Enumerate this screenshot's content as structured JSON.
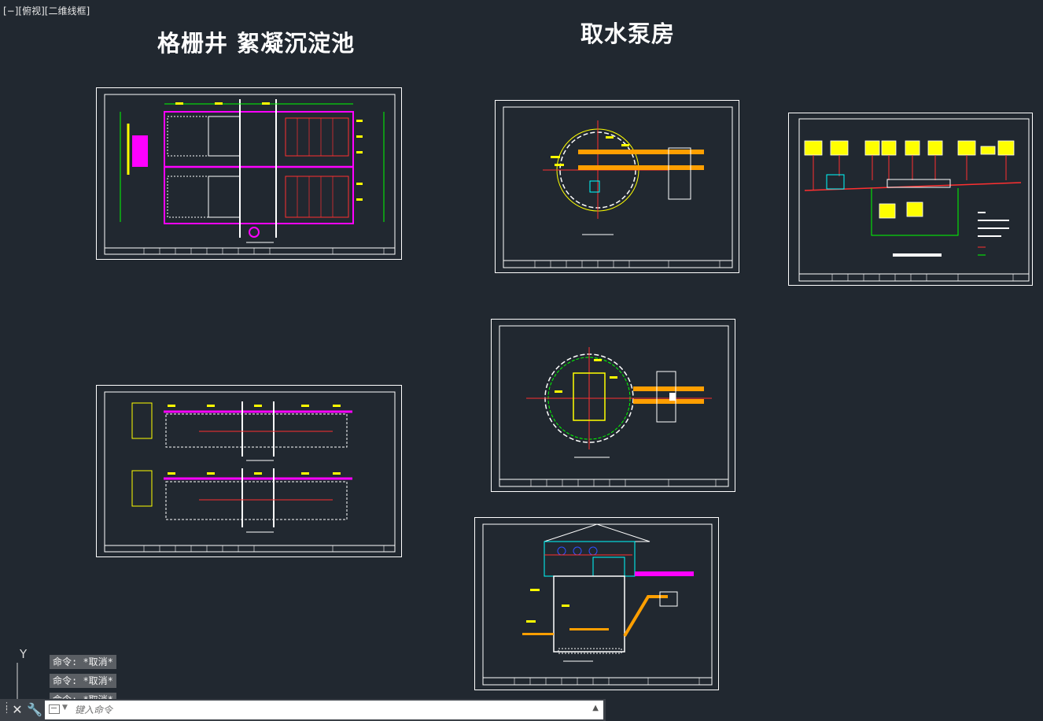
{
  "viewport": {
    "label": "[−][俯视][二维线框]"
  },
  "titles": {
    "left": "格栅井  絮凝沉淀池",
    "right": "取水泵房"
  },
  "colors": {
    "background": "#212830",
    "frame": "#ffffff",
    "yellow": "#ffff00",
    "magenta": "#ff00ff",
    "red": "#ff3030",
    "green": "#00ff00",
    "cyan": "#00ffff",
    "blue": "#3050ff",
    "orange": "#ff9f00"
  },
  "ucs": {
    "axis_label": "Y"
  },
  "command_history": [
    "命令: *取消*",
    "命令: *取消*",
    "命令: *取消*"
  ],
  "command_line": {
    "placeholder": "键入命令",
    "close_icon": "close-icon",
    "customize_icon": "wrench-icon",
    "recent_icon": "command-recent-icon",
    "expand_icon": "chevron-up-icon"
  },
  "sheets": [
    {
      "id": "grating-flocculation-plan"
    },
    {
      "id": "grating-flocculation-section"
    },
    {
      "id": "intake-pump-house-plan-upper"
    },
    {
      "id": "intake-pump-house-plan-lower"
    },
    {
      "id": "intake-pump-house-section"
    },
    {
      "id": "water-plant-process-flow"
    }
  ]
}
